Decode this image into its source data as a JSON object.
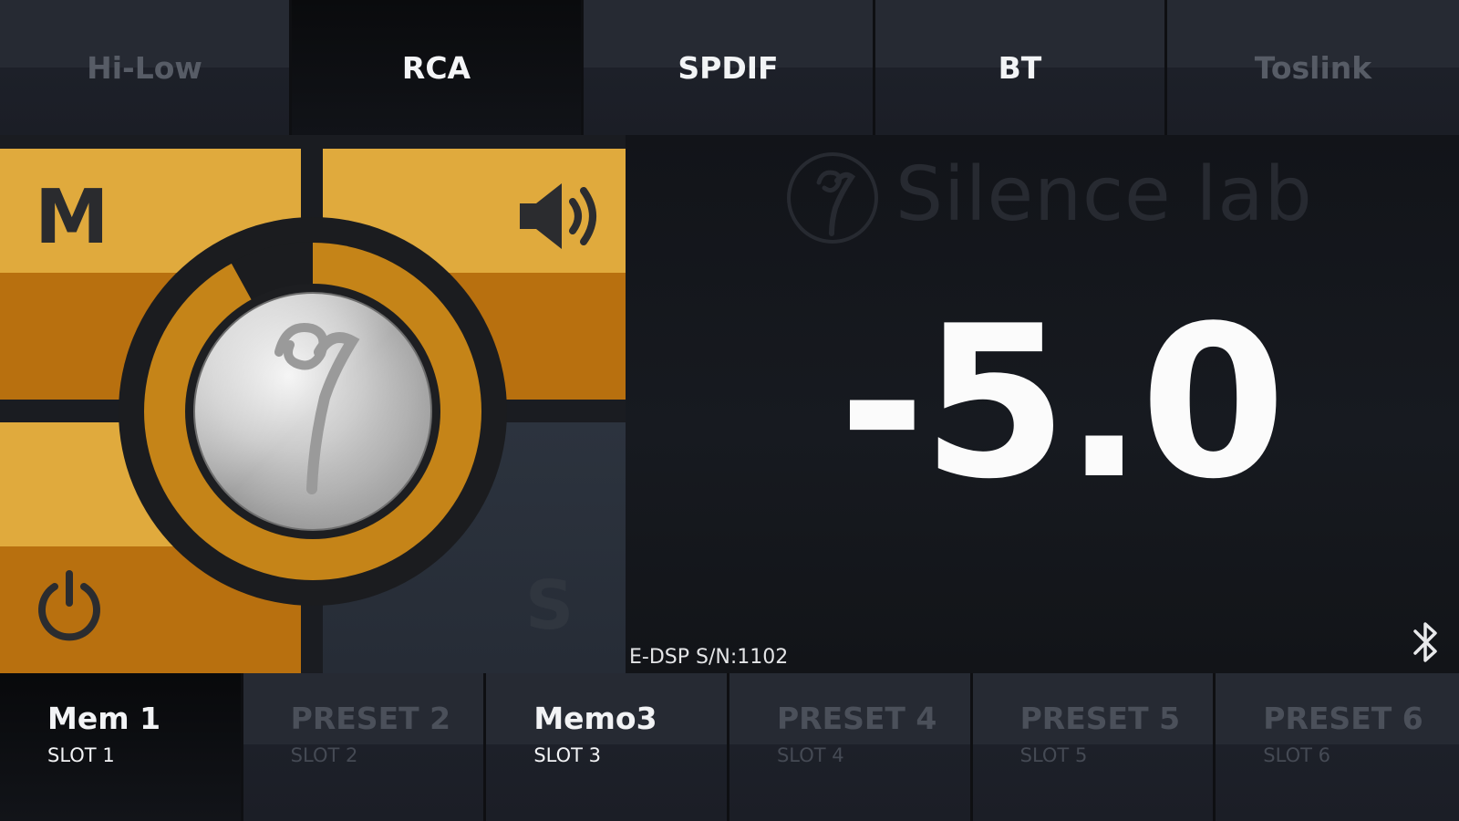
{
  "inputs": {
    "tabs": [
      {
        "label": "Hi-Low",
        "state": "dim"
      },
      {
        "label": "RCA",
        "state": "active"
      },
      {
        "label": "SPDIF",
        "state": "bright"
      },
      {
        "label": "BT",
        "state": "bright"
      },
      {
        "label": "Toslink",
        "state": "dim"
      }
    ],
    "selected": "RCA"
  },
  "pad": {
    "mode_label": "M",
    "speaker_icon": "speaker-volume-icon",
    "power_icon": "power-icon",
    "sub_label": "S",
    "knob_icon": "silence-lab-knob",
    "volume_level_fraction": 0.92
  },
  "display": {
    "brand": "Silence lab",
    "volume_value": "-5.0",
    "serial": "E-DSP S/N:1102",
    "bluetooth_icon": "bluetooth-icon"
  },
  "presets": [
    {
      "name": "Mem 1",
      "slot": "SLOT 1",
      "state": "active"
    },
    {
      "name": "PRESET 2",
      "slot": "SLOT 2",
      "state": "dim"
    },
    {
      "name": "Memo3",
      "slot": "SLOT 3",
      "state": "bright"
    },
    {
      "name": "PRESET 4",
      "slot": "SLOT 4",
      "state": "dim"
    },
    {
      "name": "PRESET 5",
      "slot": "SLOT 5",
      "state": "dim"
    },
    {
      "name": "PRESET 6",
      "slot": "SLOT 6",
      "state": "dim"
    }
  ],
  "colors": {
    "gold_light": "#e0aa3d",
    "gold_dark": "#b8700f",
    "ring_track": "#c58418",
    "background": "#121419"
  }
}
